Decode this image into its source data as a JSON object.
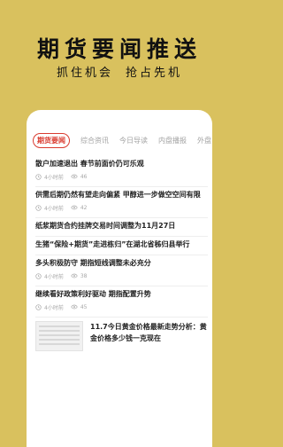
{
  "hero": {
    "title": "期货要闻推送",
    "sub1": "抓住机会",
    "sub2": "抢占先机"
  },
  "tabs": [
    {
      "label": "期货要闻",
      "active": true
    },
    {
      "label": "综合资讯",
      "active": false
    },
    {
      "label": "今日导读",
      "active": false
    },
    {
      "label": "内盘播报",
      "active": false
    },
    {
      "label": "外盘",
      "active": false
    }
  ],
  "items": [
    {
      "title": "散户加速退出 春节前面价仍可乐观",
      "time": "4小时前",
      "views": "46"
    },
    {
      "title": "供需后期仍然有望走向偏紧 甲醇进一步做空空间有限",
      "time": "4小时前",
      "views": "42"
    },
    {
      "title": "纸浆期货合约挂牌交易时间调整为11月27日",
      "time": "",
      "views": ""
    },
    {
      "title": "生猪“保险+期货”走进栋归”在湖北省秭归县举行",
      "time": "4小时前",
      "views": "47"
    },
    {
      "title": "多头积极防守 期指短线调整未必充分",
      "time": "4小时前",
      "views": "38"
    },
    {
      "title": "继续看好政策利好驱动 期指配置升势",
      "time": "4小时前",
      "views": "45"
    }
  ],
  "news": {
    "text": "11.7今日黄金价格最新走势分析：黄金价格多少钱一克现在"
  },
  "colors": {
    "background": "#d9c15e",
    "accent": "#d93b2f"
  },
  "icons": {
    "clock": "clock-icon",
    "views": "eye-icon"
  }
}
